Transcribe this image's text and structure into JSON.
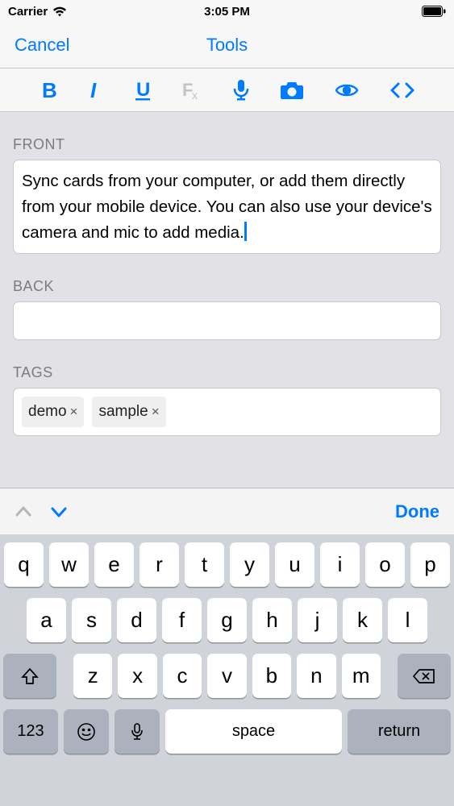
{
  "status": {
    "carrier": "Carrier",
    "time": "3:05 PM"
  },
  "nav": {
    "cancel": "Cancel",
    "title": "Tools"
  },
  "sections": {
    "front": {
      "label": "FRONT",
      "value": "Sync cards from your computer, or add them directly from your mobile device. You can also use your device's camera and mic to add media."
    },
    "back": {
      "label": "BACK",
      "value": ""
    },
    "tags": {
      "label": "TAGS",
      "items": [
        "demo",
        "sample"
      ]
    }
  },
  "kbacc": {
    "done": "Done"
  },
  "keyboard": {
    "row1": [
      "q",
      "w",
      "e",
      "r",
      "t",
      "y",
      "u",
      "i",
      "o",
      "p"
    ],
    "row2": [
      "a",
      "s",
      "d",
      "f",
      "g",
      "h",
      "j",
      "k",
      "l"
    ],
    "row3": [
      "z",
      "x",
      "c",
      "v",
      "b",
      "n",
      "m"
    ],
    "num": "123",
    "space": "space",
    "return": "return"
  }
}
